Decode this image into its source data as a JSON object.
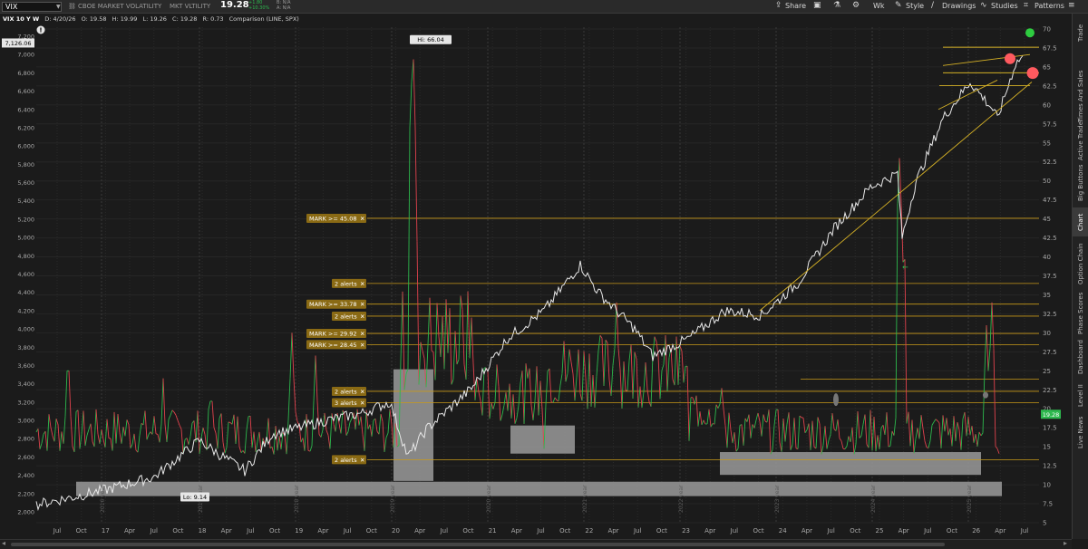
{
  "toolbar": {
    "symbol": "VIX",
    "symbol_desc": "CBOE MARKET VOLATILITY",
    "exchange": "MKT VLTILITY",
    "last": "19.28",
    "change": "+1.80",
    "change_pct": "+10.30%",
    "bid": "B: N/A",
    "ask": "A: N/A",
    "share_label": "Share",
    "wk_label": "Wk",
    "style_label": "Style",
    "drawings_label": "Drawings",
    "studies_label": "Studies",
    "patterns_label": "Patterns"
  },
  "info": {
    "title": "VIX 10 Y W",
    "date": "D: 4/20/26",
    "open": "O: 19.58",
    "high": "H: 19.99",
    "low": "L: 19.26",
    "close": "C: 19.28",
    "range": "R: 0.73",
    "comparison": "Comparison (LINE, SPX)"
  },
  "left_axis_ticks": [
    "7,200",
    "7,000",
    "6,800",
    "6,600",
    "6,400",
    "6,200",
    "6,000",
    "5,800",
    "5,600",
    "5,400",
    "5,200",
    "5,000",
    "4,800",
    "4,600",
    "4,400",
    "4,200",
    "4,000",
    "3,800",
    "3,600",
    "3,400",
    "3,200",
    "3,000",
    "2,800",
    "2,600",
    "2,400",
    "2,200",
    "2,000"
  ],
  "left_axis_marker": "7,126.06",
  "right_axis_ticks": [
    "70",
    "67.5",
    "65",
    "62.5",
    "60",
    "57.5",
    "55",
    "52.5",
    "50",
    "47.5",
    "45",
    "42.5",
    "40",
    "37.5",
    "35",
    "32.5",
    "30",
    "27.5",
    "25",
    "22.5",
    "20",
    "17.5",
    "15",
    "12.5",
    "10",
    "7.5",
    "5"
  ],
  "price_marker": "19.28",
  "x_axis_labels": [
    "Jul",
    "Oct",
    "17",
    "Apr",
    "Jul",
    "Oct",
    "18",
    "Apr",
    "Jul",
    "Oct",
    "19",
    "Apr",
    "Jul",
    "Oct",
    "20",
    "Apr",
    "Jul",
    "Oct",
    "21",
    "Apr",
    "Jul",
    "Oct",
    "22",
    "Apr",
    "Jul",
    "Oct",
    "23",
    "Apr",
    "Jul",
    "Oct",
    "24",
    "Apr",
    "Jul",
    "Oct",
    "25",
    "Apr",
    "Jul",
    "Oct",
    "26",
    "Apr",
    "Jul"
  ],
  "year_markers": [
    "2016 year",
    "2017 year",
    "2018 year",
    "2019 year",
    "2020 year",
    "2021 year",
    "2022 year",
    "2023 year",
    "2024 year",
    "2025 year"
  ],
  "hi_label": "Hi: 66.04",
  "lo_label": "Lo: 9.14",
  "alerts": [
    {
      "label": "MARK >= 45.08",
      "level": 45.08
    },
    {
      "label": "2 alerts",
      "level": 36.5
    },
    {
      "label": "MARK >= 33.78",
      "level": 33.78
    },
    {
      "label": "2 alerts",
      "level": 32.2
    },
    {
      "label": "MARK >= 29.92",
      "level": 29.92
    },
    {
      "label": "MARK >= 28.45",
      "level": 28.45
    },
    {
      "label": "2 alerts",
      "level": 22.3
    },
    {
      "label": "3 alerts",
      "level": 20.8
    },
    {
      "label": "2 alerts",
      "level": 13.3
    }
  ],
  "alert_close_glyph": "✕",
  "right_rail": [
    "Trade",
    "Times And Sales",
    "Active Trader",
    "Big Buttons",
    "Chart",
    "Option Chain",
    "Phase Scores",
    "Dashboard",
    "Level II",
    "Live News"
  ],
  "right_rail_active": "Chart",
  "colors": {
    "spx_line": "#e8e8e8",
    "vix_up": "#2db84d",
    "vix_down": "#e0424d",
    "alert_line": "#c89a1a",
    "trendline": "#d4b026",
    "zone": "#9a9a9a",
    "price_badge": "#2db84d",
    "dot_green": "#2ecc40",
    "dot_red": "#ff5a5f"
  }
}
